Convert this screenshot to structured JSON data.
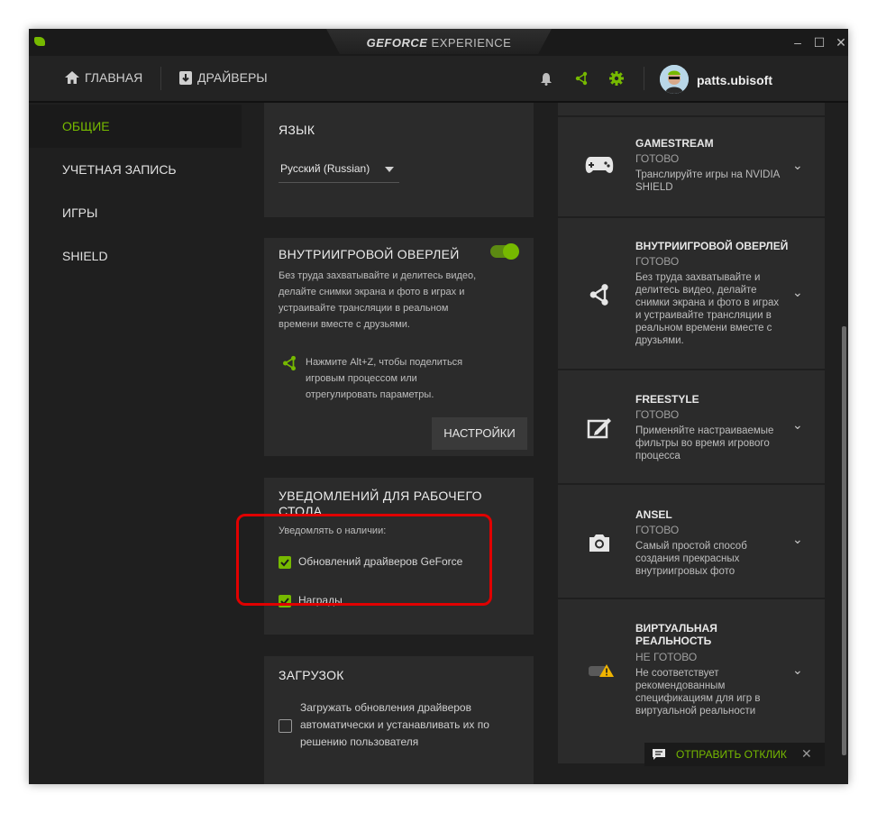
{
  "window": {
    "brand_bold": "GEFORCE",
    "brand_light": " EXPERIENCE",
    "minimize": "–",
    "maximize": "☐",
    "close": "✕"
  },
  "topnav": {
    "home_label": "ГЛАВНАЯ",
    "drivers_label": "ДРАЙВЕРЫ",
    "username": "patts.ubisoft"
  },
  "sidebar": {
    "items": [
      {
        "label": "ОБЩИЕ",
        "active": true
      },
      {
        "label": "УЧЕТНАЯ ЗАПИСЬ"
      },
      {
        "label": "ИГРЫ"
      },
      {
        "label": "SHIELD"
      }
    ]
  },
  "language_card": {
    "title": "ЯЗЫК",
    "selected": "Русский (Russian)"
  },
  "overlay_card": {
    "title": "ВНУТРИИГРОВОЙ ОВЕРЛЕЙ",
    "enabled": true,
    "desc_lines": [
      "Без труда захватывайте и делитесь видео,",
      "делайте снимки экрана и фото в играх и",
      "устраивайте трансляции в реальном",
      "времени вместе с друзьями."
    ],
    "hint_lines": [
      "Нажмите Alt+Z, чтобы поделиться",
      "игровым процессом или",
      "отрегулировать параметры."
    ],
    "settings_button": "НАСТРОЙКИ"
  },
  "notifications_card": {
    "title_lines": [
      "УВЕДОМЛЕНИЙ ДЛЯ РАБОЧЕГО",
      "СТОЛА"
    ],
    "subtitle": "Уведомлять о наличии:",
    "options": [
      {
        "label": "Обновлений драйверов GeForce",
        "checked": true
      },
      {
        "label": "Награды",
        "checked": true
      }
    ]
  },
  "downloads_card": {
    "title": "ЗАГРУЗОК",
    "option_lines": [
      "Загружать обновления драйверов",
      "автоматически и устанавливать их по",
      "решению пользователя"
    ],
    "checked": false
  },
  "features": [
    {
      "title_lines": [
        "GAMESTREAM"
      ],
      "status": "ГОТОВО",
      "desc_lines": [
        "Транслируйте игры на NVIDIA",
        "SHIELD"
      ],
      "icon": "gamepad-icon"
    },
    {
      "title_lines": [
        "ВНУТРИИГРОВОЙ ОВЕРЛЕЙ"
      ],
      "status": "ГОТОВО",
      "desc_lines": [
        "Без труда захватывайте и",
        "делитесь видео, делайте",
        "снимки экрана и фото в играх",
        "и устраивайте трансляции в",
        "реальном времени вместе с",
        "друзьями."
      ],
      "icon": "share-icon"
    },
    {
      "title_lines": [
        "FREESTYLE"
      ],
      "status": "ГОТОВО",
      "desc_lines": [
        "Применяйте настраиваемые",
        "фильтры во время игрового",
        "процесса"
      ],
      "icon": "freestyle-icon"
    },
    {
      "title_lines": [
        "ANSEL"
      ],
      "status": "ГОТОВО",
      "desc_lines": [
        "Самый простой способ",
        "создания прекрасных",
        "внутриигровых фото"
      ],
      "icon": "camera-icon"
    },
    {
      "title_lines": [
        "ВИРТУАЛЬНАЯ",
        "РЕАЛЬНОСТЬ"
      ],
      "status": "НЕ ГОТОВО",
      "desc_lines": [
        "Не соответствует",
        "рекомендованным",
        "спецификациям для игр в",
        "виртуальной реальности"
      ],
      "icon": "vr-warning-icon"
    }
  ],
  "feedback": {
    "label": "ОТПРАВИТЬ ОТКЛИК",
    "close": "✕"
  },
  "colors": {
    "accent": "#76b900",
    "highlight": "#e00000"
  }
}
